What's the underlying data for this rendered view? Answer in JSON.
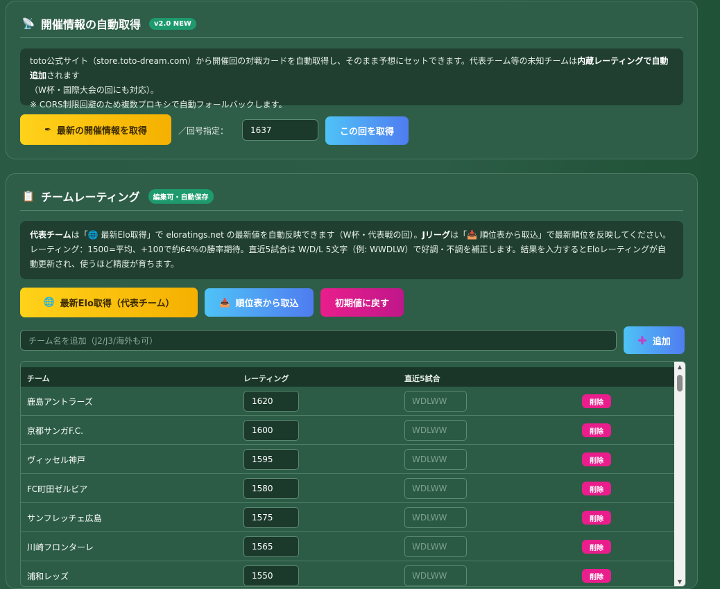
{
  "fetch_panel": {
    "icon": "satellite-icon",
    "title": "開催情報の自動取得",
    "badge": "v2.0 NEW",
    "info_line1_a": "toto公式サイト（store.toto-dream.com）から開催回の対戦カードを自動取得し、そのまま予想にセットできます。代表チーム等の未知チームは",
    "info_line1_b": "内蔵レーティングで自動追加",
    "info_line1_c": "されます",
    "info_line2": "（W杯・国際大会の回にも対応）。",
    "info_line3": "※ CORS制限回避のため複数プロキシで自動フォールバックします。",
    "fetch_latest_label": "最新の開催情報を取得",
    "round_label": "／回号指定：",
    "round_value": "1637",
    "fetch_round_label": "この回を取得"
  },
  "rating_panel": {
    "icon": "clipboard-icon",
    "title": "チームレーティング",
    "badge": "編集可・自動保存",
    "info_a": "代表チーム",
    "info_b": "は「🌐 最新Elo取得」で eloratings.net の最新値を自動反映できます（W杯・代表戦の回）。",
    "info_c": "Jリーグ",
    "info_d": "は「📥 順位表から取込」で最新順位を反映してください。レーティング：1500=平均、+100で約64%の勝率期待。直近5試合は W/D/L 5文字（例: WWDLW）で好調・不調を補正します。結果を入力するとEloレーティングが自動更新され、使うほど精度が育ちます。",
    "elo_button": "最新Elo取得（代表チーム）",
    "standings_button": "順位表から取込",
    "reset_button": "初期値に戻す",
    "add_placeholder": "チーム名を追加（J2/J3/海外も可）",
    "add_button": "追加",
    "columns": [
      "チーム",
      "レーティング",
      "直近5試合"
    ],
    "form_placeholder": "WDLWW",
    "delete_label": "削除",
    "teams": [
      {
        "name": "鹿島アントラーズ",
        "rating": "1620"
      },
      {
        "name": "京都サンガF.C.",
        "rating": "1600"
      },
      {
        "name": "ヴィッセル神戸",
        "rating": "1595"
      },
      {
        "name": "FC町田ゼルビア",
        "rating": "1580"
      },
      {
        "name": "サンフレッチェ広島",
        "rating": "1575"
      },
      {
        "name": "川崎フロンターレ",
        "rating": "1565"
      },
      {
        "name": "浦和レッズ",
        "rating": "1550"
      }
    ]
  },
  "colors": {
    "accent_yellow": "#f5b000",
    "accent_blue": "#4f7cf0",
    "accent_pink": "#e91e8c",
    "badge_green": "#1e9a6e"
  }
}
